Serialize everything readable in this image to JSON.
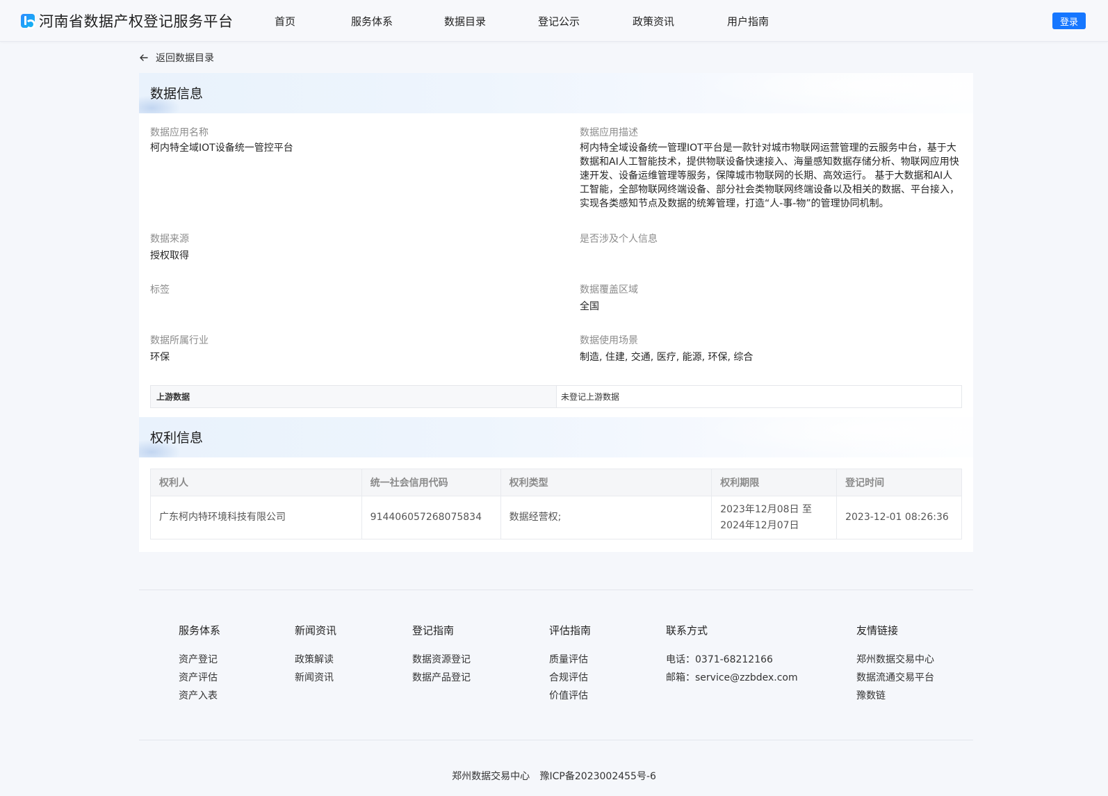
{
  "header": {
    "logo_text": "河南省数据产权登记服务平台",
    "nav": [
      "首页",
      "服务体系",
      "数据目录",
      "登记公示",
      "政策资讯",
      "用户指南"
    ],
    "login_label": "登录"
  },
  "back_label": "返回数据目录",
  "data_info": {
    "title": "数据信息",
    "fields": {
      "app_name": {
        "label": "数据应用名称",
        "value": "柯内特全域IOT设备统一管控平台"
      },
      "app_desc": {
        "label": "数据应用描述",
        "value": "柯内特全域设备统一管理IOT平台是一款针对城市物联网运营管理的云服务中台，基于大数据和AI人工智能技术，提供物联设备快速接入、海量感知数据存储分析、物联网应用快速开发、设备运维管理等服务，保障城市物联网的长期、高效运行。 基于大数据和AI人工智能，全部物联网终端设备、部分社会类物联网终端设备以及相关的数据、平台接入，实现各类感知节点及数据的统筹管理，打造“人-事-物”的管理协同机制。"
      },
      "source": {
        "label": "数据来源",
        "value": "授权取得"
      },
      "personal_info": {
        "label": "是否涉及个人信息",
        "value": ""
      },
      "tags": {
        "label": "标签",
        "value": ""
      },
      "coverage": {
        "label": "数据覆盖区域",
        "value": "全国"
      },
      "industry": {
        "label": "数据所属行业",
        "value": "环保"
      },
      "scenarios": {
        "label": "数据使用场景",
        "value": "制造, 住建, 交通, 医疗, 能源, 环保, 综合"
      }
    },
    "upstream": {
      "label": "上游数据",
      "value": "未登记上游数据"
    }
  },
  "rights_info": {
    "title": "权利信息",
    "columns": [
      "权利人",
      "统一社会信用代码",
      "权利类型",
      "权利期限",
      "登记时间"
    ],
    "rows": [
      {
        "holder": "广东柯内特环境科技有限公司",
        "credit_code": "914406057268075834",
        "type": "数据经营权;",
        "period_start": "2023年12月08日 至",
        "period_end": "2024年12月07日",
        "registered": "2023-12-01 08:26:36"
      }
    ]
  },
  "footer": {
    "columns": [
      {
        "head": "服务体系",
        "links": [
          "资产登记",
          "资产评估",
          "资产入表"
        ]
      },
      {
        "head": "新闻资讯",
        "links": [
          "政策解读",
          "新闻资讯"
        ]
      },
      {
        "head": "登记指南",
        "links": [
          "数据资源登记",
          "数据产品登记"
        ]
      },
      {
        "head": "评估指南",
        "links": [
          "质量评估",
          "合规评估",
          "价值评估"
        ]
      },
      {
        "head": "联系方式",
        "info": [
          "电话：0371-68212166",
          "邮箱：service@zzbdex.com"
        ]
      },
      {
        "head": "友情链接",
        "links": [
          "郑州数据交易中心",
          "数据流通交易平台",
          "豫数链"
        ]
      }
    ],
    "copyright_org": "郑州数据交易中心",
    "icp": "豫ICP备2023002455号-6"
  }
}
